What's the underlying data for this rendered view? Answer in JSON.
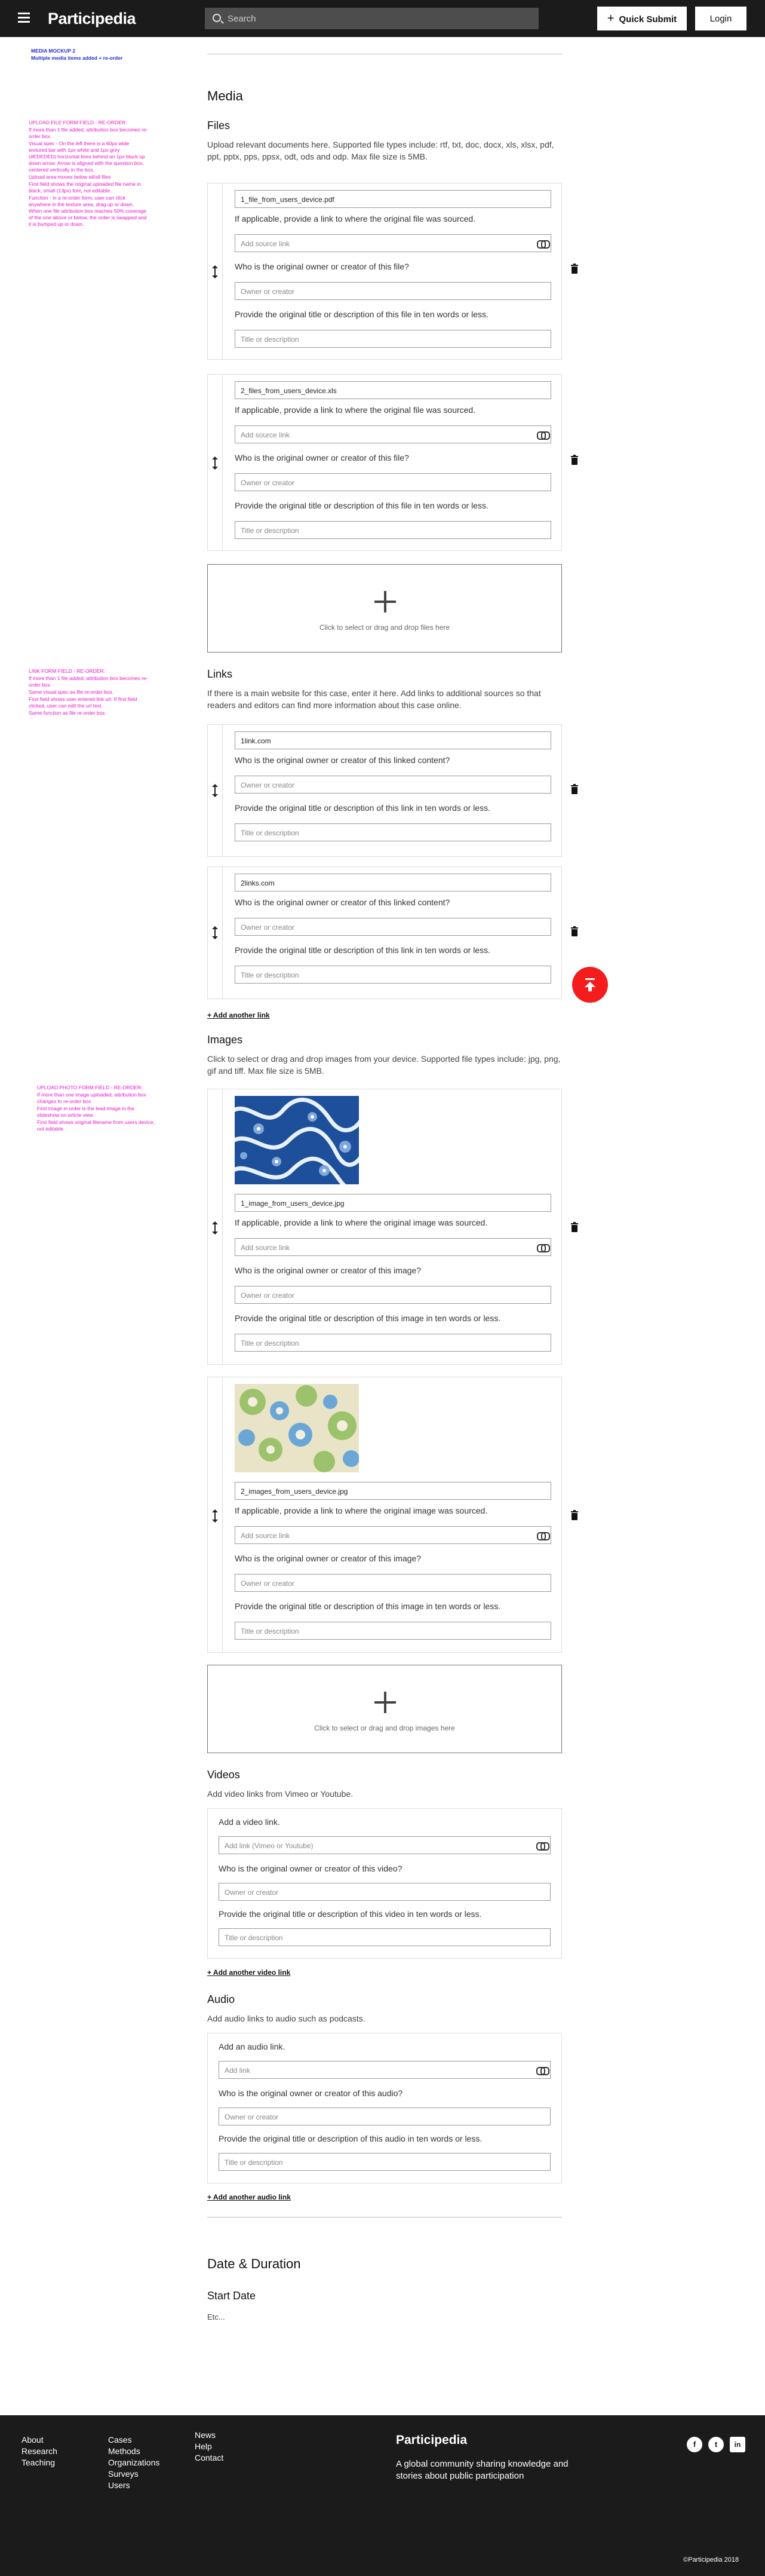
{
  "header": {
    "logo": "Participedia",
    "search_placeholder": "Search",
    "quick_submit_label": "Quick Submit",
    "login_label": "Login"
  },
  "annotations": {
    "mockup_title": "MEDIA MOCKUP 2",
    "mockup_subtitle": "Multiple media items added + re-order",
    "files": [
      "UPLOAD FILE FORM FIELD - RE-ORDER:",
      "If more than 1 file added, attribution box becomes re-order box.",
      "Visual spec - On the left there is a 60px wide textured bar with 1px white and 1px grey (#EDEDED) horizontal lines behind an 1px black up down arrow. Arrow is aligned with the question box, centered vertically in the box.",
      "Upload area moves below all/all files",
      "First field shows the original uploaded file name in black, small (13px) font, not editable.",
      "Function - in a re-order form, user can click anywhere in the texture area, drag up or down. When one file attribution box reaches 50% coverage of the one above or below, the order is swapped and it is bumped up or down."
    ],
    "links": [
      "LINK FORM FIELD - RE-ORDER:",
      "If more than 1 file added, attribution box becomes re-order box.",
      "Same visual spec as file re-order box.",
      "First field shows user entered link url. If first field clicked, user can edit the url text.",
      "Same function as file re-order box."
    ],
    "photos": [
      "UPLOAD PHOTO FORM FIELD - RE-ORDER:",
      "If more than one image uploaded, attribution box changes to re-order box.",
      "First image in order is the lead image in the slideshow on article view.",
      "First field shows original filename from users device, not editable."
    ]
  },
  "media": {
    "title": "Media",
    "files": {
      "heading": "Files",
      "description": "Upload relevant documents here. Supported file types include: rtf, txt, doc, docx, xls, xlsx, pdf, ppt, pptx, pps, ppsx, odt, ods and odp. Max file size is 5MB.",
      "items": [
        {
          "filename": "1_file_from_users_device.pdf",
          "source_question": "If applicable, provide a link to where the original file was sourced.",
          "source_placeholder": "Add source link",
          "owner_question": "Who is the original owner or creator of this file?",
          "owner_placeholder": "Owner or creator",
          "title_question": "Provide the original title or description of this file in ten words or less.",
          "title_placeholder": "Title or description"
        },
        {
          "filename": "2_files_from_users_device.xls",
          "source_question": "If applicable, provide a link to where the original file was sourced.",
          "source_placeholder": "Add source link",
          "owner_question": "Who is the original owner or creator of this file?",
          "owner_placeholder": "Owner or creator",
          "title_question": "Provide the original title or description of this file in ten words or less.",
          "title_placeholder": "Title or description"
        }
      ],
      "dropzone_text": "Click to select or drag and drop files here"
    },
    "links": {
      "heading": "Links",
      "description": "If there is a main website for this case, enter it here. Add links to additional sources so that readers and editors can find more information about this case online.",
      "items": [
        {
          "url": "1link.com",
          "owner_question": "Who is the original owner or creator of this linked content?",
          "owner_placeholder": "Owner or creator",
          "title_question": "Provide the original title or description of this link in ten words or less.",
          "title_placeholder": "Title or description"
        },
        {
          "url": "2links.com",
          "owner_question": "Who is the original owner or creator of this linked content?",
          "owner_placeholder": "Owner or creator",
          "title_question": "Provide the original title or description of this link in ten words or less.",
          "title_placeholder": "Title or description"
        }
      ],
      "add_label": "+ Add another link"
    },
    "images": {
      "heading": "Images",
      "description": "Click to select or drag and drop images from your device. Supported file types include: jpg, png, gif and tiff. Max file size is 5MB.",
      "items": [
        {
          "filename": "1_image_from_users_device.jpg",
          "source_question": "If applicable, provide a link to where the original image was sourced.",
          "source_placeholder": "Add source link",
          "owner_question": "Who is the original owner or creator of this image?",
          "owner_placeholder": "Owner or creator",
          "title_question": "Provide the original title or description of this image in ten words or less.",
          "title_placeholder": "Title or description"
        },
        {
          "filename": "2_images_from_users_device.jpg",
          "source_question": "If applicable, provide a link to where the original image was sourced.",
          "source_placeholder": "Add source link",
          "owner_question": "Who is the original owner or creator of this image?",
          "owner_placeholder": "Owner or creator",
          "title_question": "Provide the original title or description of this image in ten words or less.",
          "title_placeholder": "Title or description"
        }
      ],
      "dropzone_text": "Click to select or drag and drop images here"
    },
    "videos": {
      "heading": "Videos",
      "description": "Add video links from Vimeo or Youtube.",
      "link_label": "Add a video link.",
      "link_placeholder": "Add link (Vimeo or Youtube)",
      "owner_question": "Who is the original owner or creator of this video?",
      "owner_placeholder": "Owner or creator",
      "title_question": "Provide the original title or description of this video in ten words or less.",
      "title_placeholder": "Title or description",
      "add_label": "+ Add another video link"
    },
    "audio": {
      "heading": "Audio",
      "description": "Add audio links to audio such as podcasts.",
      "link_label": "Add an audio link.",
      "link_placeholder": "Add link",
      "owner_question": "Who is the original owner or creator of this audio?",
      "owner_placeholder": "Owner or creator",
      "title_question": "Provide the original title or description of this audio in ten words or less.",
      "title_placeholder": "Title or description",
      "add_label": "+ Add another audio link"
    }
  },
  "date_duration": {
    "title": "Date & Duration",
    "start_date_label": "Start Date",
    "etc": "Etc..."
  },
  "footer": {
    "col1": [
      "About",
      "Research",
      "Teaching"
    ],
    "col2": [
      "Cases",
      "Methods",
      "Organizations",
      "Surveys",
      "Users"
    ],
    "col3": [
      "News",
      "Help",
      "Contact"
    ],
    "logo": "Participedia",
    "tagline": "A global community sharing knowledge and stories about public participation",
    "social": [
      "facebook-icon",
      "twitter-icon",
      "linkedin-icon"
    ],
    "social_glyphs": [
      "f",
      "t",
      "in"
    ],
    "copyright": "©Participedia 2018"
  }
}
